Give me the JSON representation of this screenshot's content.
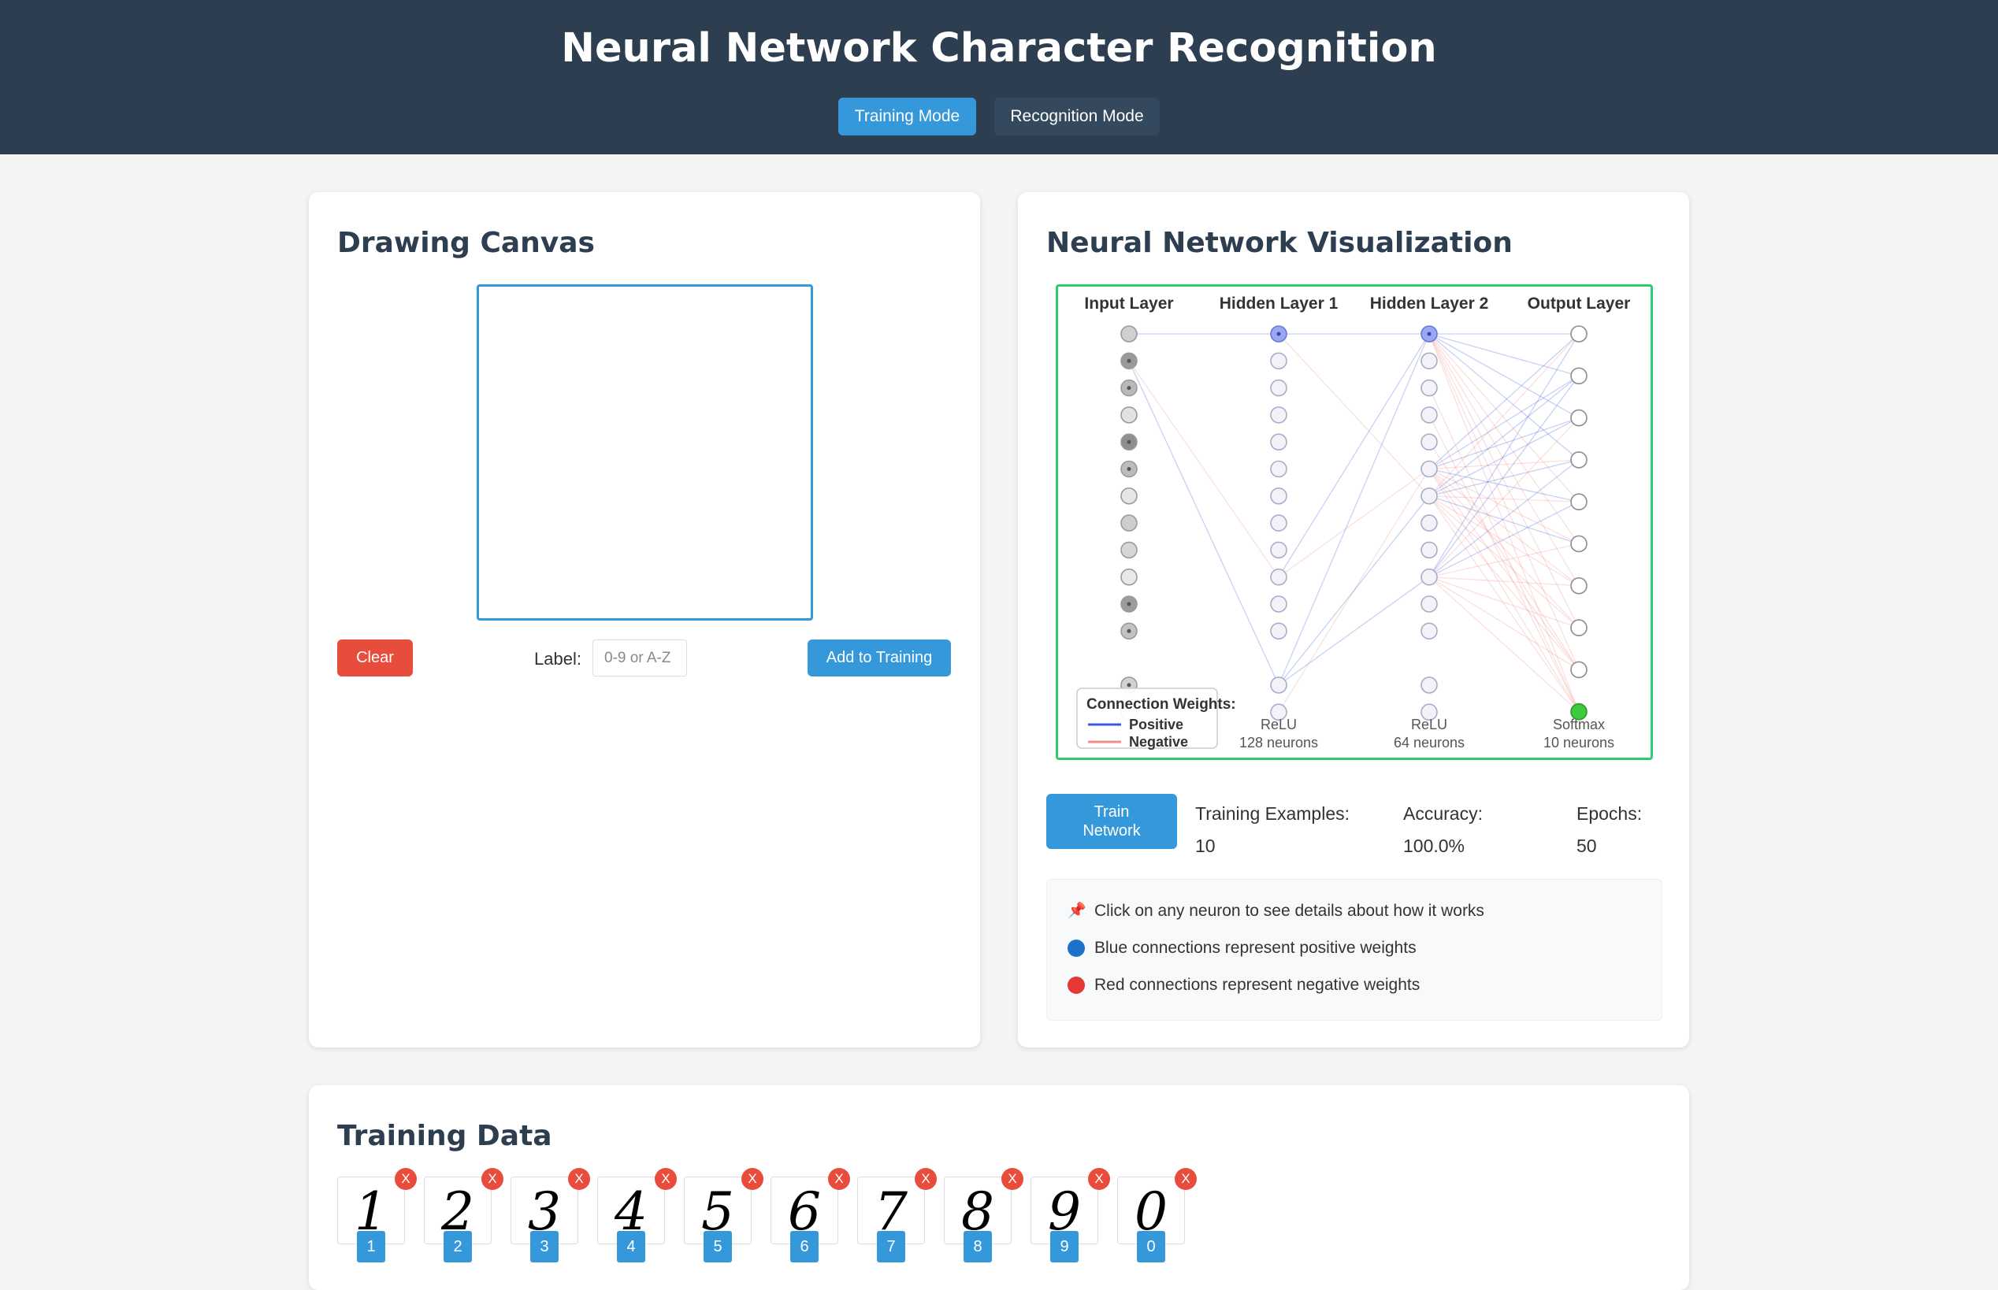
{
  "header": {
    "title": "Neural Network Character Recognition",
    "modes": [
      {
        "label": "Training Mode",
        "active": true
      },
      {
        "label": "Recognition Mode",
        "active": false
      }
    ]
  },
  "drawing": {
    "title": "Drawing Canvas",
    "clear_label": "Clear",
    "label_text": "Label:",
    "label_placeholder": "0-9 or A-Z",
    "add_label": "Add to Training"
  },
  "visualization": {
    "title": "Neural Network Visualization",
    "layers": [
      {
        "name": "Input Layer",
        "activation": "",
        "neurons": ""
      },
      {
        "name": "Hidden Layer 1",
        "activation": "ReLU",
        "neurons": "128 neurons"
      },
      {
        "name": "Hidden Layer 2",
        "activation": "ReLU",
        "neurons": "64 neurons"
      },
      {
        "name": "Output Layer",
        "activation": "Softmax",
        "neurons": "10 neurons"
      }
    ],
    "legend": {
      "title": "Connection Weights:",
      "positive": "Positive",
      "negative": "Negative"
    },
    "colors": {
      "positive": "#3b5bdb",
      "negative": "#f28b8b",
      "frame": "#2ecc71",
      "output_active": "#3ec93e"
    }
  },
  "training": {
    "button_label": "Train\nNetwork",
    "stats": [
      {
        "label": "Training Examples:",
        "value": "10"
      },
      {
        "label": "Accuracy:",
        "value": "100.0%"
      },
      {
        "label": "Epochs:",
        "value": "50"
      }
    ]
  },
  "info": {
    "lines": [
      {
        "icon": "pin-icon",
        "text": "Click on any neuron to see details about how it works"
      },
      {
        "icon": "blue-dot-icon",
        "text": "Blue connections represent positive weights"
      },
      {
        "icon": "red-dot-icon",
        "text": "Red connections represent negative weights"
      }
    ]
  },
  "training_data": {
    "title": "Training Data",
    "delete_label": "X",
    "samples": [
      {
        "glyph": "1",
        "label": "1"
      },
      {
        "glyph": "2",
        "label": "2"
      },
      {
        "glyph": "3",
        "label": "3"
      },
      {
        "glyph": "4",
        "label": "4"
      },
      {
        "glyph": "5",
        "label": "5"
      },
      {
        "glyph": "6",
        "label": "6"
      },
      {
        "glyph": "7",
        "label": "7"
      },
      {
        "glyph": "8",
        "label": "8"
      },
      {
        "glyph": "9",
        "label": "9"
      },
      {
        "glyph": "0",
        "label": "0"
      }
    ]
  }
}
